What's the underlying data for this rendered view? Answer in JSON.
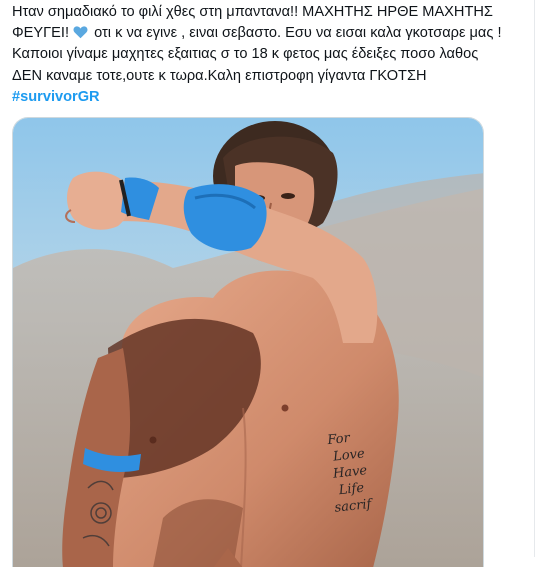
{
  "tweet": {
    "line1": "Ηταν σημαδιακό το φιλί χθες στη μπανταναǃǃ ΜΑΧΗΤΗΣ ΗΡΘΕ ΜΑΧΗΤΗΣ",
    "line2_before_emoji": "ΦΕΥΓΕΙǃ",
    "heart_emoji": "blue-heart-emoji",
    "line2_after_emoji": "οτι κ να εγινε , ειναι σεβαστο. Εσυ να εισαι καλα γκοτσαρε μας !",
    "line3": "Καποιοι γίναμε μαχητες εξαιτιας σ το 18 κ φετος μας έδειξες ποσο λαθος",
    "line4": "ΔΕΝ καναμε τοτε,ουτε κ τωρα.Καλη επιστροφη γίγαντα ΓΚΟΤΣΗ",
    "hashtag": "#survivorGR"
  },
  "media": {
    "description_icon": "photo-attachment",
    "tattoo_text": [
      "For",
      "Love",
      "Have",
      "Life",
      "sacrif"
    ]
  },
  "colors": {
    "text": "#0f1419",
    "hashtag": "#1d9bf0",
    "heart": "#5aa8e0",
    "bandana": "#2f8fe0"
  }
}
